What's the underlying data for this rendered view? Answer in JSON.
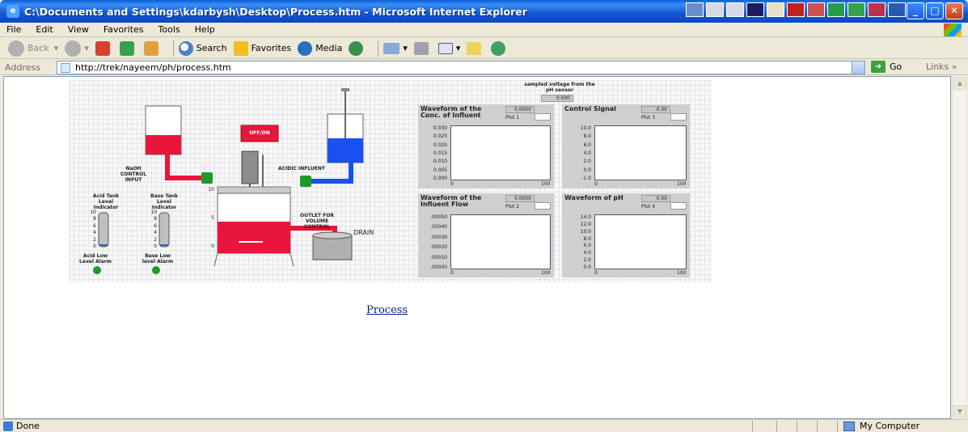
{
  "window": {
    "title": "C:\\Documents and Settings\\kdarbysh\\Desktop\\Process.htm - Microsoft Internet Explorer"
  },
  "menu": [
    "File",
    "Edit",
    "View",
    "Favorites",
    "Tools",
    "Help"
  ],
  "toolbar": {
    "back": "Back",
    "search": "Search",
    "favorites": "Favorites",
    "media": "Media"
  },
  "address": {
    "label": "Address",
    "url": "http://trek/nayeem/ph/process.htm",
    "go": "Go",
    "links": "Links"
  },
  "status": {
    "text": "Done",
    "zone": "My Computer"
  },
  "vi": {
    "sensor_label": "sampled voltage from the pH sensor",
    "sensor_value": "0.000",
    "offon": "OFF/ON",
    "naoh_label": "NaOH CONTROL INPUT",
    "acidic_label": "ACIDIC INFLUENT",
    "acid_level_label": "Acid Tank Level Indicator",
    "base_level_label": "Base Tank Level Indicator",
    "outlet_label": "OUTLET FOR VOLUME CONTROL",
    "drain_label": "DRAIN",
    "acid_alarm": "Acid Low Level Alarm",
    "base_alarm": "Base Low level Alarm",
    "level_ticks": [
      "10",
      "8",
      "6",
      "4",
      "2",
      "0"
    ],
    "reactor_ticks": [
      "10",
      "5",
      "0"
    ],
    "acid_level": 0.05,
    "base_level": 0.05
  },
  "charts": [
    {
      "title": "Waveform of the Conc. of Influent",
      "value": "0.0000",
      "plot": "Plot 1",
      "yticks": [
        "0.030",
        "0.025",
        "0.020",
        "0.015",
        "0.010",
        "0.005",
        "0.000"
      ],
      "xticks": [
        "0",
        "100"
      ]
    },
    {
      "title": "Control Signal",
      "value": "0.00",
      "plot": "Plot 3",
      "yticks": [
        "10.0",
        "8.0",
        "6.0",
        "4.0",
        "2.0",
        "0.0",
        "-1.0"
      ],
      "xticks": [
        "0",
        "100"
      ]
    },
    {
      "title": "Waveform of the Influent Flow",
      "value": "0.0000",
      "plot": "Plot 2",
      "yticks": [
        ".00050",
        ".00040",
        ".00030",
        ".00020",
        ".00010",
        ".00000"
      ],
      "xticks": [
        "0",
        "100"
      ]
    },
    {
      "title": "Waveform of pH",
      "value": "0.00",
      "plot": "Plot 4",
      "yticks": [
        "14.0",
        "12.0",
        "10.0",
        "8.0",
        "6.0",
        "4.0",
        "2.0",
        "0.0"
      ],
      "xticks": [
        "0",
        "100"
      ]
    }
  ],
  "link": {
    "process": "Process"
  }
}
